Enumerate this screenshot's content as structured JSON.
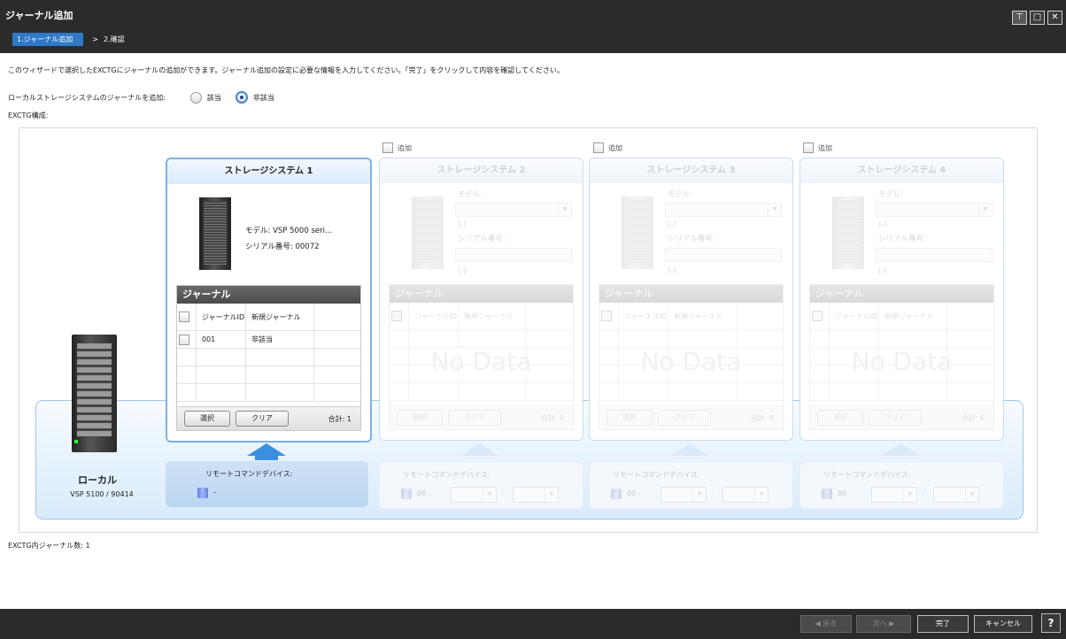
{
  "window": {
    "title": "ジャーナル追加",
    "buttons": [
      "⊤",
      "□",
      "✕"
    ]
  },
  "steps": {
    "current": "1.ジャーナル追加",
    "separator": ">",
    "next": "2.確認"
  },
  "intro_text": "このウィザードで選択したEXCTGにジャーナルの追加ができます。ジャーナル追加の設定に必要な情報を入力してください。「完了」をクリックして内容を確認してください。",
  "local_journal": {
    "label": "ローカルストレージシステムのジャーナルを追加:",
    "option_yes": "該当",
    "option_no": "非該当",
    "selected": "非該当"
  },
  "exctg_label": "EXCTG構成:",
  "local": {
    "name": "ローカル",
    "model": "VSP 5100 / 90414"
  },
  "add_label": "追加",
  "system1": {
    "title": "ストレージシステム 1",
    "model_label": "モデル:",
    "model_value": "VSP 5000 seri...",
    "serial_label": "シリアル番号:",
    "serial_value": "00072",
    "journal_header": "ジャーナル",
    "col_journal_id": "ジャーナルID",
    "col_new_journal": "新規ジャーナル",
    "rows": [
      {
        "id": "001",
        "new": "非該当"
      }
    ],
    "select_btn": "選択",
    "clear_btn": "クリア",
    "total": "合計: 1"
  },
  "dim_systems": [
    {
      "title": "ストレージシステム 2"
    },
    {
      "title": "ストレージシステム 3"
    },
    {
      "title": "ストレージシステム 4"
    }
  ],
  "dim_common": {
    "model_label": "モデル:",
    "model_placeholder": "(-)",
    "serial_label": "シリアル番号:",
    "serial_placeholder": "(-)",
    "journal_header": "ジャーナル",
    "col_journal_id": "ジャーナルID",
    "col_new_journal": "新規ジャーナル",
    "no_data": "No Data",
    "select_btn": "選択",
    "clear_btn": "クリア",
    "total": "合計: 0"
  },
  "remote_cmd": {
    "label": "リモートコマンドデバイス:",
    "main_value": "-",
    "dim_value": "00 :",
    "colon": ":"
  },
  "journal_count": "EXCTG内ジャーナル数: 1",
  "footer": {
    "back": "◀ 戻る",
    "next": "次へ ▶",
    "finish": "完了",
    "cancel": "キャンセル",
    "help": "?"
  }
}
